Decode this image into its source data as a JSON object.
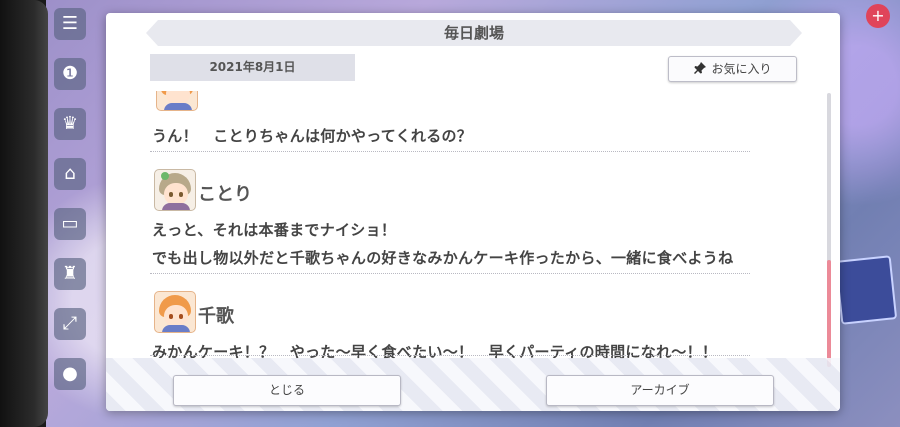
{
  "dialog": {
    "title": "毎日劇場",
    "date": "2021年8月1日",
    "favorite_label": "お気に入り",
    "close_label": "とじる",
    "archive_label": "アーカイブ"
  },
  "log": {
    "entry_prev": {
      "line": "うん！　ことりちゃんは何かやってくれるの？"
    },
    "entry_kotori": {
      "speaker": "ことり",
      "lines": [
        "えっと、それは本番までナイショ！",
        "でも出し物以外だと千歌ちゃんの好きなみかんケーキ作ったから、一緒に食べようね"
      ]
    },
    "entry_chika": {
      "speaker": "千歌",
      "line": "みかんケーキ！？　やった〜早く食べたい〜！　早くパーティの時間になれ〜！！"
    }
  },
  "colors": {
    "accent_scroll": "#ec8a98",
    "kotori_hair": "#b8a98a",
    "chika_hair": "#f09a4a"
  }
}
